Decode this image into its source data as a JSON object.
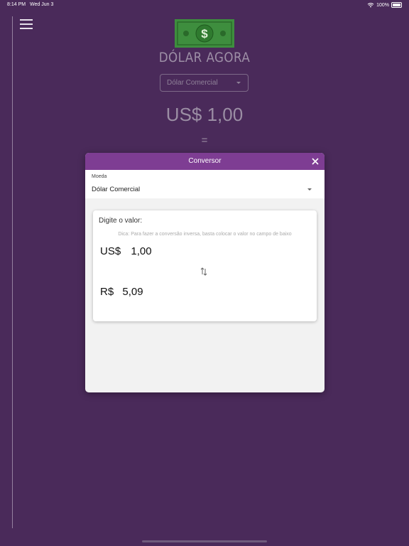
{
  "status_bar": {
    "time": "8:14 PM",
    "date": "Wed Jun 3",
    "battery": "100%"
  },
  "app": {
    "title": "DÓLAR AGORA",
    "selector": "Dólar Comercial",
    "amount": "US$ 1,00",
    "equals": "="
  },
  "modal": {
    "title": "Conversor",
    "currency_label": "Moeda",
    "currency_value": "Dólar Comercial",
    "card_title": "Digite o valor:",
    "hint": "Dica: Para fazer a conversão inversa, basta colocar o valor no campo de baixo",
    "usd_symbol": "US$",
    "usd_value": "1,00",
    "brl_symbol": "R$",
    "brl_value": "5,09"
  },
  "colors": {
    "background": "#4a2a5a",
    "modal_header": "#7e3d93",
    "logo_green": "#3e8e3e"
  },
  "icons": [
    "menu-icon",
    "dollar-bill-logo",
    "chevron-down-icon",
    "close-icon",
    "swap-icon",
    "wifi-icon",
    "battery-icon"
  ]
}
